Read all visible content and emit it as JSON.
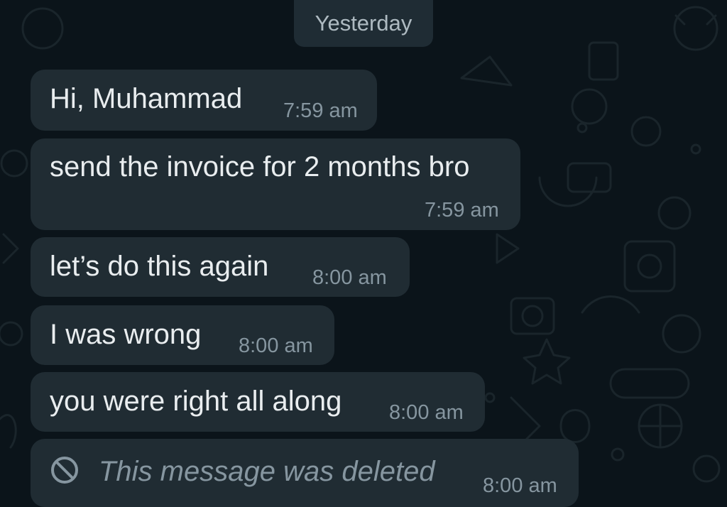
{
  "date_separator": "Yesterday",
  "messages": [
    {
      "text": "Hi, Muhammad",
      "time": "7:59 am"
    },
    {
      "text": "send the invoice for 2 months bro",
      "time": "7:59 am"
    },
    {
      "text": "let’s do this again",
      "time": "8:00 am"
    },
    {
      "text": "I was wrong",
      "time": "8:00 am"
    },
    {
      "text": "you were right all along",
      "time": "8:00 am"
    },
    {
      "text": "This message was deleted",
      "time": "8:00 am",
      "icon": "block-icon"
    }
  ],
  "colors": {
    "background": "#0b141a",
    "bubble": "#202c33",
    "text": "#e9edef",
    "meta": "#8696a0"
  }
}
